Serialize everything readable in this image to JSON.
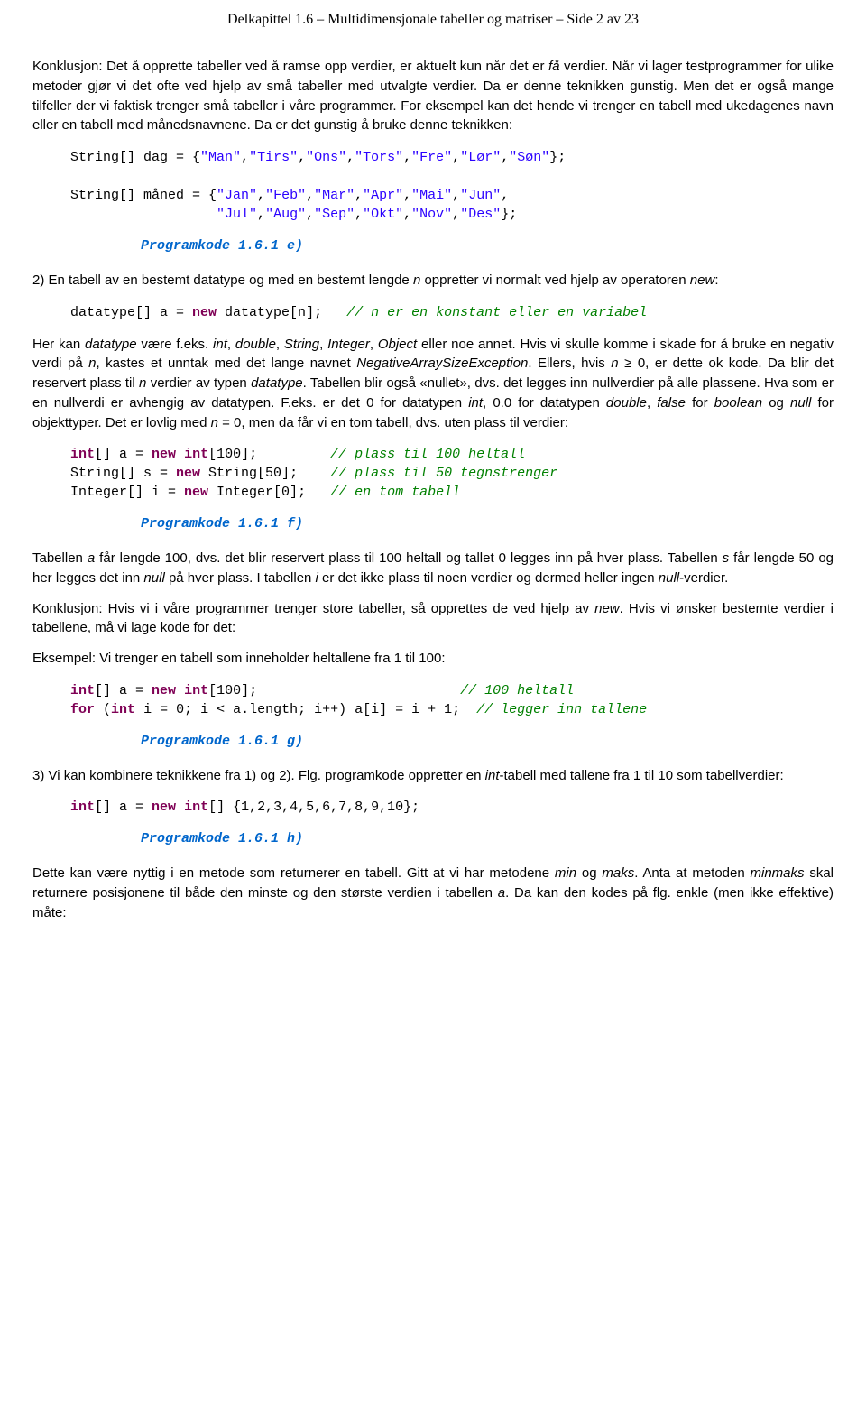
{
  "header": "Delkapittel 1.6 – Multidimensjonale tabeller og matriser – Side 2 av 23",
  "p1a": "Konklusjon: Det å opprette tabeller ved å ramse opp verdier, er aktuelt kun når det er ",
  "p1b": "få",
  "p1c": " verdier. Når vi lager testprogrammer for ulike metoder gjør vi det ofte ved hjelp av små tabeller med utvalgte verdier. Da er denne teknikken gunstig. Men det er også mange tilfeller der vi faktisk trenger små tabeller i våre programmer. For eksempel kan det hende vi trenger en tabell med ukedagenes navn eller en tabell med månedsnavnene. Da er det gunstig å bruke denne teknikken:",
  "code1": {
    "l1a": "  String[] dag = {",
    "l1b": "\"Man\"",
    "l1c": ",",
    "l1d": "\"Tirs\"",
    "l1e": ",",
    "l1f": "\"Ons\"",
    "l1g": ",",
    "l1h": "\"Tors\"",
    "l1i": ",",
    "l1j": "\"Fre\"",
    "l1k": ",",
    "l1l": "\"Lør\"",
    "l1m": ",",
    "l1n": "\"Søn\"",
    "l1o": "};",
    "l2a": "  String[] måned = {",
    "l2b": "\"Jan\"",
    "l2c": ",",
    "l2d": "\"Feb\"",
    "l2e": ",",
    "l2f": "\"Mar\"",
    "l2g": ",",
    "l2h": "\"Apr\"",
    "l2i": ",",
    "l2j": "\"Mai\"",
    "l2k": ",",
    "l2l": "\"Jun\"",
    "l2m": ",",
    "l3a": "                    ",
    "l3b": "\"Jul\"",
    "l3c": ",",
    "l3d": "\"Aug\"",
    "l3e": ",",
    "l3f": "\"Sep\"",
    "l3g": ",",
    "l3h": "\"Okt\"",
    "l3i": ",",
    "l3j": "\"Nov\"",
    "l3k": ",",
    "l3l": "\"Des\"",
    "l3m": "};"
  },
  "cap1": "Programkode 1.6.1 e)",
  "p2a": "2)  En tabell av en bestemt datatype og med en bestemt lengde ",
  "p2b": "n",
  "p2c": " oppretter vi normalt ved hjelp av operatoren ",
  "p2d": "new",
  "p2e": ":",
  "code2": {
    "a": "  datatype[] a = ",
    "b": "new",
    "c": " datatype[n];   ",
    "d": "// n er en konstant eller en variabel"
  },
  "p3a": "Her kan ",
  "p3b": "datatype",
  "p3c": " være f.eks. ",
  "p3d": "int",
  "p3e": ", ",
  "p3f": "double",
  "p3g": ", ",
  "p3h": "String",
  "p3i": ", ",
  "p3j": "Integer",
  "p3k": ", ",
  "p3l": "Object",
  "p3m": " eller noe annet. Hvis vi skulle komme i skade for å bruke en negativ verdi på ",
  "p3n": "n",
  "p3o": ", kastes et unntak med det lange navnet ",
  "p3p": "NegativeArraySizeException",
  "p3q": ". Ellers, hvis ",
  "p3r": "n",
  "p3s": " ≥ 0, er dette ok kode. Da blir det reservert plass til ",
  "p3t": "n",
  "p3u": " verdier av typen ",
  "p3v": "datatype",
  "p3w": ". Tabellen blir også «nullet», dvs. det legges inn nullverdier på alle plassene. Hva som er en nullverdi er avhengig av datatypen. F.eks. er det 0 for datatypen ",
  "p3x": "int",
  "p3y": ", 0.0 for datatypen ",
  "p3z": "double",
  "p3aa": ", ",
  "p3ab": "false",
  "p3ac": " for ",
  "p3ad": "boolean",
  "p3ae": " og ",
  "p3af": "null",
  "p3ag": " for objekttyper. Det er lovlig med ",
  "p3ah": "n",
  "p3ai": " = 0, men da får vi en tom tabell, dvs. uten plass til verdier:",
  "code3": {
    "l1a": "  ",
    "l1b": "int",
    "l1c": "[] a = ",
    "l1d": "new",
    "l1e": " ",
    "l1f": "int",
    "l1g": "[100];         ",
    "l1h": "// plass til 100 heltall",
    "l2a": "  String[] s = ",
    "l2b": "new",
    "l2c": " String[50];    ",
    "l2d": "// plass til 50 tegnstrenger",
    "l3a": "  Integer[] i = ",
    "l3b": "new",
    "l3c": " Integer[0];   ",
    "l3d": "// en tom tabell"
  },
  "cap2": "Programkode 1.6.1 f)",
  "p4a": "Tabellen ",
  "p4b": "a",
  "p4c": " får lengde 100, dvs. det blir reservert plass til 100 heltall og tallet 0 legges inn på hver plass. Tabellen ",
  "p4d": "s",
  "p4e": " får lengde 50 og her legges det inn ",
  "p4f": "null",
  "p4g": " på hver plass. I tabellen ",
  "p4h": "i",
  "p4i": " er det ikke plass til noen verdier og dermed heller ingen ",
  "p4j": "null",
  "p4k": "-verdier.",
  "p5a": "Konklusjon: Hvis vi i våre programmer trenger store tabeller, så opprettes de ved hjelp av ",
  "p5b": "new",
  "p5c": ". Hvis vi ønsker bestemte verdier i tabellene, må vi lage kode for det:",
  "p6": "Eksempel: Vi trenger en tabell som inneholder heltallene fra 1 til 100:",
  "code4": {
    "l1a": "  ",
    "l1b": "int",
    "l1c": "[] a = ",
    "l1d": "new",
    "l1e": " ",
    "l1f": "int",
    "l1g": "[100];                         ",
    "l1h": "// 100 heltall",
    "l2a": "  ",
    "l2b": "for",
    "l2c": " (",
    "l2d": "int",
    "l2e": " i = 0; i < a.length; i++) a[i] = i + 1;  ",
    "l2f": "// legger inn tallene"
  },
  "cap3": "Programkode 1.6.1 g)",
  "p7a": "3)  Vi kan kombinere teknikkene fra 1) og 2). Flg. programkode oppretter en ",
  "p7b": "int",
  "p7c": "-tabell med tallene fra 1 til 10 som tabellverdier:",
  "code5": {
    "a": "  ",
    "b": "int",
    "c": "[] a = ",
    "d": "new",
    "e": " ",
    "f": "int",
    "g": "[] {1,2,3,4,5,6,7,8,9,10};"
  },
  "cap4": "Programkode 1.6.1 h)",
  "p8a": "Dette kan være nyttig i en metode som returnerer en tabell. Gitt at vi har metodene ",
  "p8b": "min",
  "p8c": " og ",
  "p8d": "maks",
  "p8e": ". Anta at metoden ",
  "p8f": "minmaks",
  "p8g": " skal returnere posisjonene til både den minste og den største verdien i tabellen ",
  "p8h": "a",
  "p8i": ". Da kan den kodes på flg. enkle (men ikke effektive) måte:"
}
